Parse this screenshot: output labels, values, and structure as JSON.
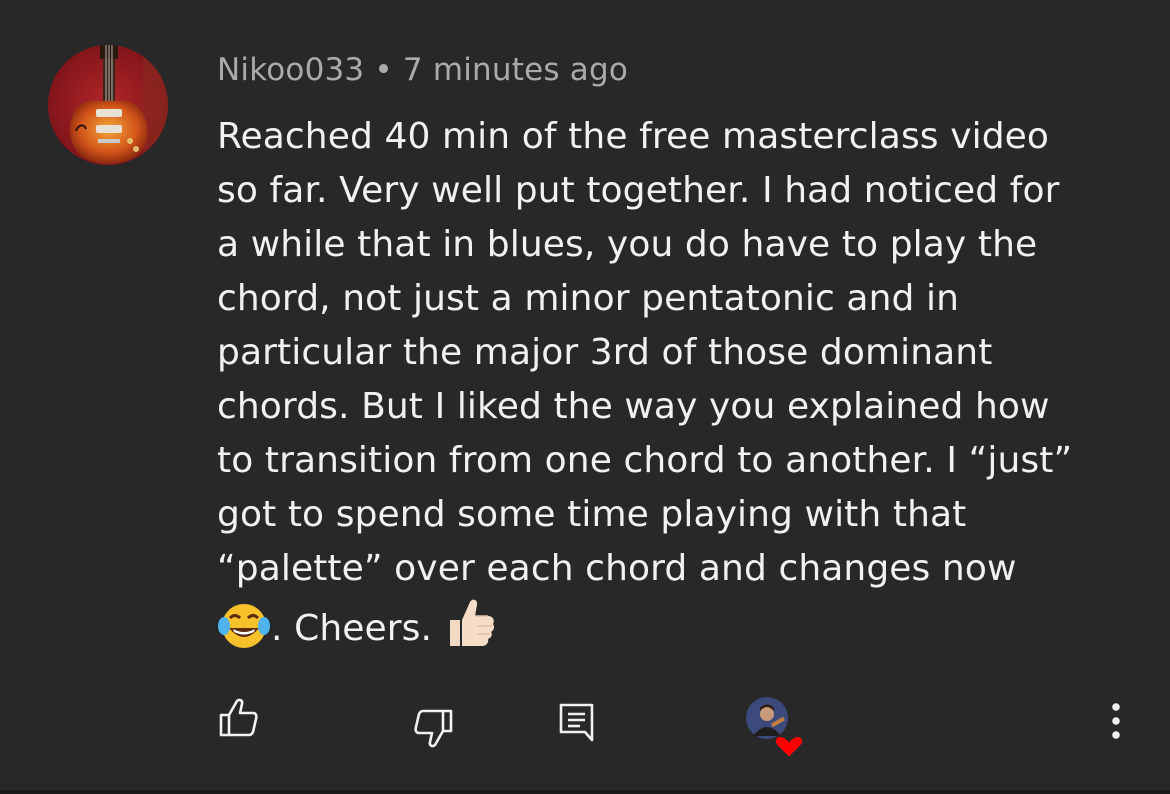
{
  "comment": {
    "author": "Nikoo033",
    "separator": "•",
    "time": "7 minutes ago",
    "lines": [
      "Reached 40 min of the free masterclass video",
      "so far. Very well put together. I had noticed for",
      "a while that in blues, you do have to play the",
      "chord, not just a minor pentatonic and in",
      "particular the major 3rd of those dominant",
      "chords. But I liked the way you explained how",
      "to transition from one chord to another. I “just”",
      "got to spend some time playing with that",
      "“palette” over each chord and changes now"
    ],
    "last_line_text": ". Cheers.",
    "emojis": [
      "face-with-tears-of-joy",
      "thumbs-up-light-skin"
    ]
  },
  "actions": {
    "like": "thumbs-up-icon",
    "dislike": "thumbs-down-icon",
    "reply": "reply-comment-icon",
    "creator_heart": "creator-heart-badge",
    "more": "more-options-icon"
  },
  "colors": {
    "background": "#282828",
    "text": "#f1f1f1",
    "meta": "#aaaaaa",
    "heart": "#ff0000"
  }
}
